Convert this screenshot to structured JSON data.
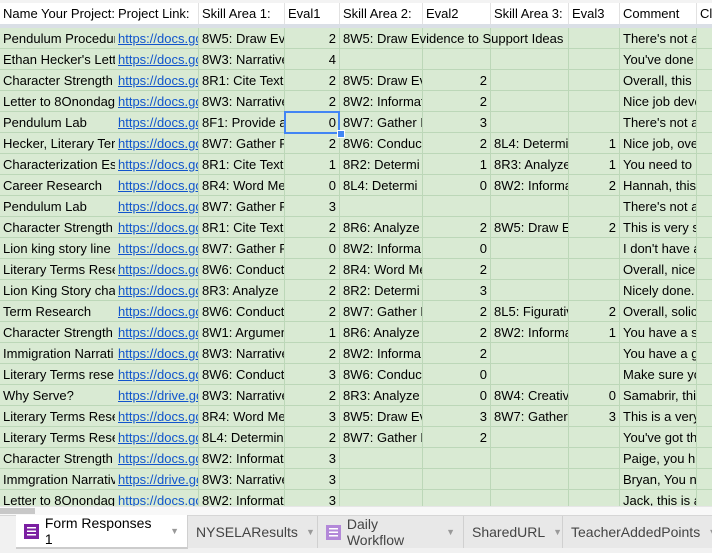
{
  "headers": [
    "Name Your Project:",
    "Project Link:",
    "Skill Area 1:",
    "Eval1",
    "Skill Area 2:",
    "Eval2",
    "Skill Area 3:",
    "Eval3",
    "Comment",
    "Cl"
  ],
  "rows": [
    [
      "Pendulum Procedur",
      "https://docs.go",
      "8W5: Draw Ev",
      "2",
      "8W5: Draw Evidence to Support Ideas",
      "",
      "",
      "",
      "There's not a"
    ],
    [
      "Ethan Hecker's Lett",
      "https://docs.go",
      "8W3: Narrative",
      "4",
      "",
      "",
      "",
      "",
      "You've done"
    ],
    [
      "Character Strength",
      "https://docs.go",
      "8R1: Cite Text",
      "2",
      "8W5: Draw Ev",
      "2",
      "",
      "",
      "Overall, this"
    ],
    [
      "Letter to 8Onondag",
      "https://docs.go",
      "8W3: Narrative",
      "2",
      "8W2: Informat",
      "2",
      "",
      "",
      "Nice job deve"
    ],
    [
      "Pendulum Lab",
      "https://docs.go",
      "8F1: Provide a",
      "0",
      "8W7: Gather I",
      "3",
      "",
      "",
      "There's not a"
    ],
    [
      "Hecker, Literary Ter",
      "https://docs.go",
      "8W7: Gather F",
      "2",
      "8W6: Conduc",
      "2",
      "8L4: Determi",
      "1",
      "Nice job, ove"
    ],
    [
      "Characterization Es",
      "https://docs.go",
      "8R1: Cite Text",
      "1",
      "8R2: Determi",
      "1",
      "8R3: Analyze",
      "1",
      "You need to"
    ],
    [
      "Career Research",
      "https://docs.go",
      "8R4: Word Me",
      "0",
      "8L4: Determi",
      "0",
      "8W2: Informa",
      "2",
      "Hannah, this"
    ],
    [
      "Pendulum Lab",
      "https://docs.go",
      "8W7: Gather F",
      "3",
      "",
      "",
      "",
      "",
      "There's not a"
    ],
    [
      "Character Strength",
      "https://docs.go",
      "8R1: Cite Text",
      "2",
      "8R6: Analyze",
      "2",
      "8W5: Draw E",
      "2",
      "This is very s"
    ],
    [
      "Lion king story line",
      "https://docs.go",
      "8W7: Gather F",
      "0",
      "8W2: Informa",
      "0",
      "",
      "",
      "I don't have a"
    ],
    [
      "Literary Terms Rese",
      "https://docs.go",
      "8W6: Conduct",
      "2",
      "8R4: Word Me",
      "2",
      "",
      "",
      "Overall, nice"
    ],
    [
      "Lion King Story cha",
      "https://docs.go",
      "8R3: Analyze",
      "2",
      "8R2: Determi",
      "3",
      "",
      "",
      "Nicely done."
    ],
    [
      "Term Research",
      "https://docs.go",
      "8W6: Conduct",
      "2",
      "8W7: Gather I",
      "2",
      "8L5: Figurativ",
      "2",
      "Overall, solic"
    ],
    [
      "Character Strength",
      "https://docs.go",
      "8W1: Argumen",
      "1",
      "8R6: Analyze",
      "2",
      "8W2: Informa",
      "1",
      "You have a s"
    ],
    [
      "Immigration Narrati",
      "https://docs.go",
      "8W3: Narrative",
      "2",
      "8W2: Informa",
      "2",
      "",
      "",
      "You have a g"
    ],
    [
      "Literary Terms rese",
      "https://docs.go",
      "8W6: Conduct",
      "3",
      "8W6: Conduc",
      "0",
      "",
      "",
      "Make sure yo"
    ],
    [
      "Why Serve?",
      "https://drive.go",
      "8W3: Narrative",
      "2",
      "8R3: Analyze",
      "0",
      "8W4: Creativ",
      "0",
      "Samabrir, thi"
    ],
    [
      "Literary Terms Rese",
      "https://docs.go",
      "8R4: Word Me",
      "3",
      "8W5: Draw Ev",
      "3",
      "8W7: Gather",
      "3",
      "This is a very"
    ],
    [
      "Literary Terms Rese",
      "https://docs.go",
      "8L4: Determin",
      "2",
      "8W7: Gather I",
      "2",
      "",
      "",
      "You've got th"
    ],
    [
      "Character Strength",
      "https://docs.go",
      "8W2: Informat",
      "3",
      "",
      "",
      "",
      "",
      "Paige, you h"
    ],
    [
      "Immgration Narrativ",
      "https://drive.go",
      "8W3: Narrative",
      "3",
      "",
      "",
      "",
      "",
      "Bryan, You n"
    ],
    [
      "Letter to 8Onondag",
      "https://docs.go",
      "8W2: Informat",
      "3",
      "",
      "",
      "",
      "",
      "Jack, this is a"
    ]
  ],
  "selected_cell": {
    "row": 5,
    "column": "Eval1"
  },
  "sheet_tabs": [
    {
      "label": "Form Responses 1",
      "active": true,
      "icon": "form-icon"
    },
    {
      "label": "NYSELAResults",
      "active": false
    },
    {
      "label": "Daily Workflow",
      "active": false,
      "icon": "form-icon"
    },
    {
      "label": "SharedURL",
      "active": false
    },
    {
      "label": "TeacherAddedPoints",
      "active": false
    }
  ],
  "colors": {
    "row_fill": "#d9ead3",
    "link": "#1155cc",
    "selection": "#4285f4",
    "form_icon": "#7b1fa2"
  }
}
